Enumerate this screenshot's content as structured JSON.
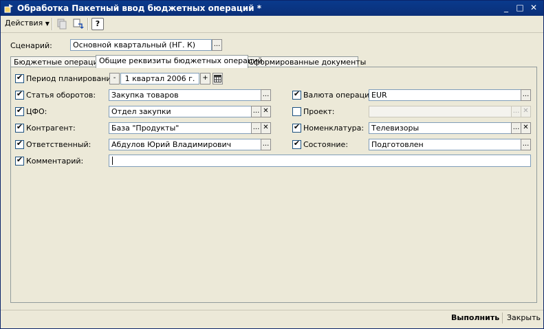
{
  "window": {
    "title": "Обработка  Пакетный ввод бюджетных операций *",
    "minimize": "_",
    "maximize": "□",
    "close": "✕"
  },
  "toolbar": {
    "actions_label": "Действия",
    "help_label": "?"
  },
  "scenario": {
    "label": "Сценарий:",
    "value": "Основной квартальный (НГ. К)",
    "button": "..."
  },
  "tabs": [
    {
      "label": "Бюджетные операции",
      "active": false
    },
    {
      "label": "Общие реквизиты бюджетных операций",
      "active": true
    },
    {
      "label": "Сформированные документы",
      "active": false
    }
  ],
  "form": {
    "period": {
      "label": "Период планирования:",
      "checked": true,
      "minus": "-",
      "value": "1 квартал 2006 г.",
      "plus": "+"
    },
    "turnover": {
      "label": "Статья оборотов:",
      "checked": true,
      "value": "Закупка товаров",
      "button": "..."
    },
    "cfo": {
      "label": "ЦФО:",
      "checked": true,
      "value": "Отдел закупки",
      "button": "...",
      "clear": "✕"
    },
    "counterparty": {
      "label": "Контрагент:",
      "checked": true,
      "value": "База \"Продукты\"",
      "button": "...",
      "clear": "✕"
    },
    "responsible": {
      "label": "Ответственный:",
      "checked": true,
      "value": "Абдулов Юрий Владимирович",
      "button": "..."
    },
    "comment": {
      "label": "Комментарий:",
      "checked": true,
      "value": ""
    },
    "currency": {
      "label": "Валюта операции:",
      "checked": true,
      "value": "EUR",
      "button": "..."
    },
    "project": {
      "label": "Проект:",
      "checked": false,
      "value": "",
      "button": "...",
      "clear": "✕"
    },
    "nomenclature": {
      "label": "Номенклатура:",
      "checked": true,
      "value": "Телевизоры",
      "button": "...",
      "clear": "✕"
    },
    "state": {
      "label": "Состояние:",
      "checked": true,
      "value": "Подготовлен",
      "button": "..."
    }
  },
  "footer": {
    "run_label": "Выполнить",
    "close_label": "Закрыть"
  },
  "colors": {
    "titlebar": "#0a3a8c",
    "window_bg": "#ece9d8",
    "field_border": "#7f9db9"
  }
}
